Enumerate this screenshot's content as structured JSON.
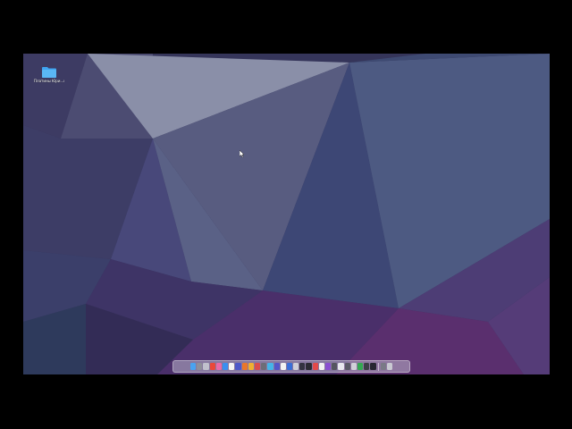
{
  "desktop": {
    "icons": [
      {
        "label": "Платины Юри...плова",
        "icon": "folder-icon",
        "color": "#3fa4f0"
      }
    ]
  },
  "dock": {
    "items": [
      {
        "icon": "finder-icon",
        "color": "#4aa3f0"
      },
      {
        "icon": "launchpad-icon",
        "color": "#8f8f9a"
      },
      {
        "icon": "mission-control-icon",
        "color": "#c0c0cc"
      },
      {
        "icon": "yandex-browser-icon",
        "color": "#e9493a"
      },
      {
        "icon": "photo-app-icon",
        "color": "#e96aa8"
      },
      {
        "icon": "safari-icon",
        "color": "#3b8ff0"
      },
      {
        "icon": "calendar-icon",
        "color": "#f3f3f3"
      },
      {
        "icon": "app-icon-1",
        "color": "#4d58c8"
      },
      {
        "icon": "app-icon-2",
        "color": "#e9772a"
      },
      {
        "icon": "app-icon-3",
        "color": "#f0b030"
      },
      {
        "icon": "app-icon-4",
        "color": "#d94d4d"
      },
      {
        "icon": "app-icon-5",
        "color": "#6d6d78"
      },
      {
        "icon": "app-icon-6",
        "color": "#46b4e8"
      },
      {
        "icon": "app-icon-7",
        "color": "#5555c8"
      },
      {
        "icon": "app-icon-8",
        "color": "#f2f2f2"
      },
      {
        "icon": "app-icon-9",
        "color": "#3a6fd8"
      },
      {
        "icon": "app-icon-10",
        "color": "#cfcfd8"
      },
      {
        "icon": "app-icon-11",
        "color": "#333340"
      },
      {
        "icon": "app-icon-12",
        "color": "#2b2b33"
      },
      {
        "icon": "app-icon-13",
        "color": "#e24a4a"
      },
      {
        "icon": "app-icon-14",
        "color": "#f0f0f0"
      },
      {
        "icon": "app-icon-15",
        "color": "#8a4fd0"
      },
      {
        "icon": "app-icon-16",
        "color": "#555560"
      },
      {
        "icon": "app-icon-17",
        "color": "#e8e8ee"
      },
      {
        "icon": "app-icon-18",
        "color": "#5a5a66"
      },
      {
        "icon": "app-icon-19",
        "color": "#d0d0d8"
      },
      {
        "icon": "app-icon-20",
        "color": "#35a852"
      },
      {
        "icon": "app-icon-21",
        "color": "#3e3e48"
      },
      {
        "icon": "app-icon-22",
        "color": "#262630"
      }
    ],
    "trailing": [
      {
        "icon": "downloads-icon",
        "color": "#7a7a86"
      },
      {
        "icon": "trash-icon",
        "color": "#c9c9d2"
      }
    ]
  }
}
